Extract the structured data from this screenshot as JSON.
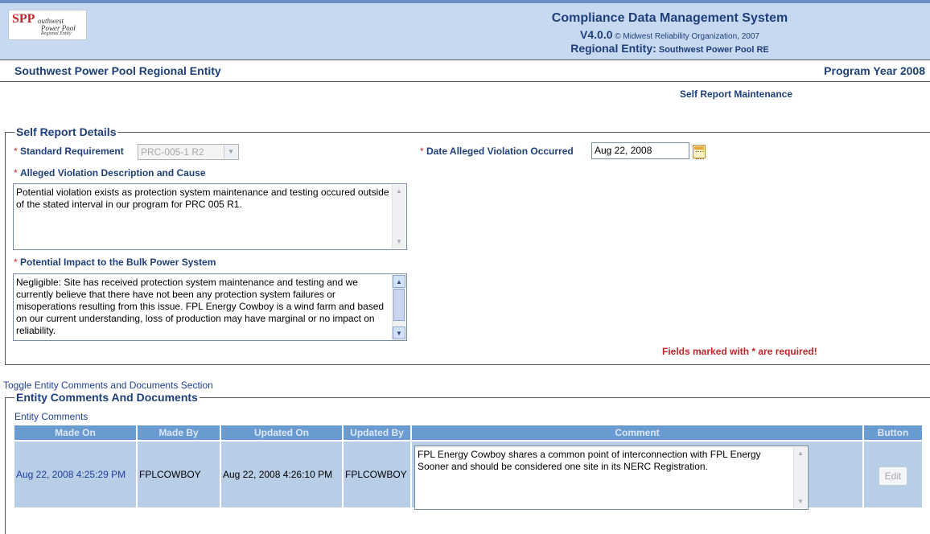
{
  "header": {
    "logo": {
      "mark": "SPP",
      "line1": "outhwest",
      "line2": "Power Pool",
      "line3": "Regional Entity"
    },
    "system_title": "Compliance Data Management System",
    "version": "V4.0.0",
    "copyright": "© Midwest Reliability Organization, 2007",
    "region_label": "Regional Entity:",
    "region_value": "Southwest Power Pool RE"
  },
  "entity_bar": {
    "entity_name": "Southwest Power Pool Regional Entity",
    "program_year": "Program Year 2008"
  },
  "page_title": "Self Report Maintenance",
  "self_report": {
    "legend": "Self Report Details",
    "required_marker": "*",
    "standard_requirement": {
      "label": "Standard Requirement",
      "value": "PRC-005-1 R2"
    },
    "date_alleged": {
      "label": "Date Alleged Violation Occurred",
      "value": "Aug 22, 2008"
    },
    "description": {
      "label": "Alleged Violation Description and Cause",
      "value": "Potential violation exists as protection system maintenance and testing occured outside of the stated interval in our program for PRC 005 R1."
    },
    "impact": {
      "label": "Potential Impact to the Bulk Power System",
      "value": "Negligible: Site has received protection system maintenance and testing and we currently believe that there have not been any protection system failures or misoperations resulting from this issue.  FPL Energy Cowboy is a wind farm and based on our current understanding, loss of production may have marginal or no impact on reliability."
    },
    "required_note": "Fields marked with * are required!"
  },
  "toggle_link": "Toggle Entity Comments and Documents Section",
  "comments": {
    "legend": "Entity Comments And Documents",
    "subheading": "Entity Comments",
    "columns": [
      "Made On",
      "Made By",
      "Updated On",
      "Updated By",
      "Comment",
      "Button"
    ],
    "rows": [
      {
        "made_on": "Aug 22, 2008 4:25:29 PM",
        "made_by": "FPLCOWBOY",
        "updated_on": "Aug 22, 2008 4:26:10 PM",
        "updated_by": "FPLCOWBOY",
        "comment": "FPL Energy Cowboy  shares a common point of interconnection with FPL Energy Sooner and should be considered one site in its NERC Registration.",
        "button": "Edit"
      }
    ]
  },
  "colors": {
    "header_bg": "#c6d9f1",
    "title_blue": "#1f3f7a",
    "required_red": "#c0272d",
    "table_header": "#6a9bd0",
    "table_cell": "#b8cde6"
  }
}
